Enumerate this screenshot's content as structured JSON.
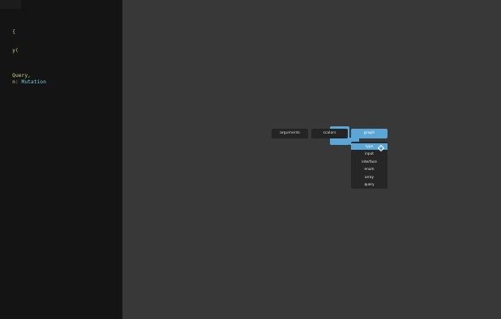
{
  "editor": {
    "lines": [
      {
        "text": "{",
        "type": "plain"
      },
      {
        "text": "y(",
        "type": "plain"
      },
      {
        "text": "Query,",
        "type": "plain"
      },
      {
        "text": "n: ",
        "type": "plain",
        "suffix": "Mutation"
      }
    ]
  },
  "nodes": {
    "arguments_label": "arguments",
    "scalars_label": "scalars",
    "graph_label": "graph"
  },
  "dropdown": {
    "items": [
      {
        "label": "type",
        "selected": true
      },
      {
        "label": "input",
        "selected": false
      },
      {
        "label": "interface",
        "selected": false
      },
      {
        "label": "enum",
        "selected": false
      },
      {
        "label": "array",
        "selected": false
      },
      {
        "label": "query",
        "selected": false
      }
    ]
  },
  "colors": {
    "accent": "#5aa6d6",
    "code_keyword": "#cfcf8a",
    "code_type": "#6fd0e6",
    "editor_bg": "#141414",
    "canvas_bg": "#383838",
    "node_bg": "#242424"
  }
}
